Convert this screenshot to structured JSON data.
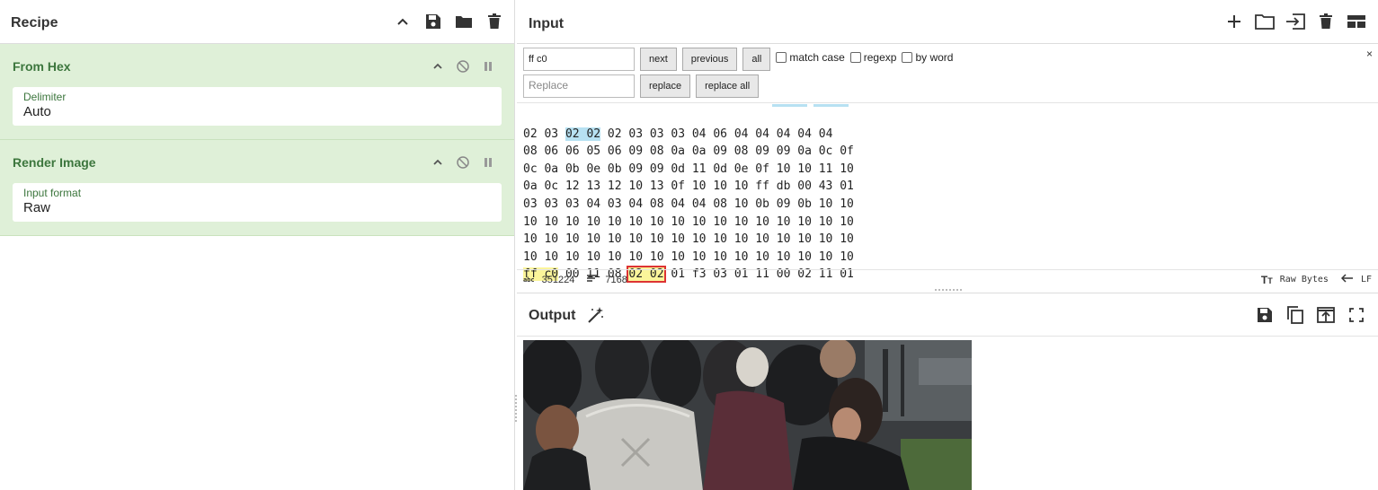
{
  "recipe": {
    "title": "Recipe",
    "operations": [
      {
        "name": "From Hex",
        "arg_label": "Delimiter",
        "arg_value": "Auto"
      },
      {
        "name": "Render Image",
        "arg_label": "Input format",
        "arg_value": "Raw"
      }
    ]
  },
  "input": {
    "title": "Input",
    "search": {
      "find_value": "ff c0",
      "replace_placeholder": "Replace",
      "next_label": "next",
      "previous_label": "previous",
      "all_label": "all",
      "match_case_label": "match case",
      "regexp_label": "regexp",
      "by_word_label": "by word",
      "replace_label": "replace",
      "replace_all_label": "replace all",
      "close_label": "×"
    },
    "hex_lines": [
      [
        "02 03 ",
        "02 02",
        " 02 03 03 03 04 06 04 04 04 04 04"
      ],
      [
        "08 06 06 05 06 09 08 0a 0a 09 08 09 09 0a 0c 0f"
      ],
      [
        "0c 0a 0b 0e 0b 09 09 0d 11 0d 0e 0f 10 10 11 10"
      ],
      [
        "0a 0c 12 13 12 10 13 0f 10 10 10 ff db 00 43 01"
      ],
      [
        "03 03 03 04 03 04 08 04 04 08 10 0b 09 0b 10 10"
      ],
      [
        "10 10 10 10 10 10 10 10 10 10 10 10 10 10 10 10"
      ],
      [
        "10 10 10 10 10 10 10 10 10 10 10 10 10 10 10 10"
      ],
      [
        "10 10 10 10 10 10 10 10 10 10 10 10 10 10 10 10"
      ],
      [
        "ff c0",
        " 00 11 08 ",
        "02 02",
        " 01 f3 03 01 11 00 02 11 01"
      ]
    ],
    "status": {
      "length_icon_label": "abc",
      "length": "351224",
      "lines": "7168",
      "encoding": "Raw Bytes",
      "eol": "LF"
    }
  },
  "output": {
    "title": "Output"
  },
  "colors": {
    "op_bg": "#dff0d8",
    "op_text": "#3c763d",
    "highlight_blue": "#b7e1f2",
    "highlight_yellow": "#fbf59a",
    "selection_border": "#dd3333"
  }
}
